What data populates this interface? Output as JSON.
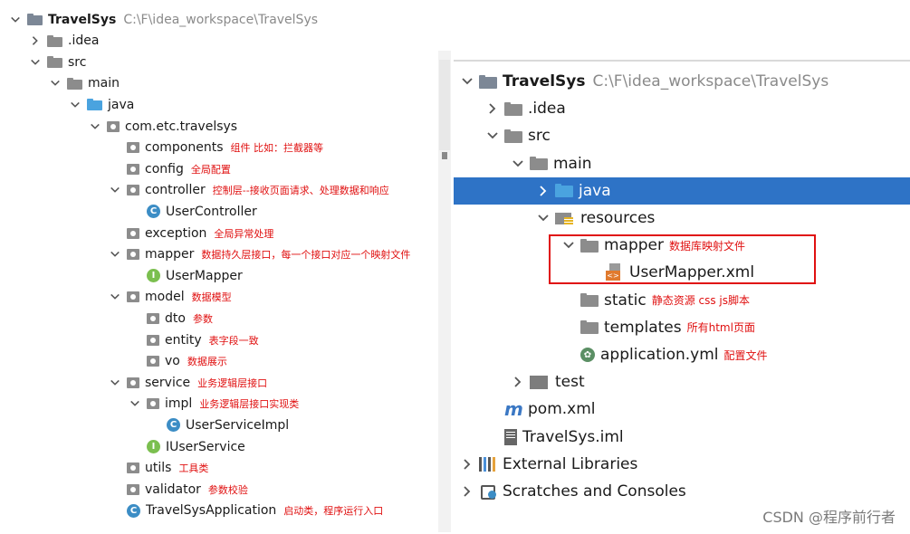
{
  "left_tree": [
    {
      "level": 0,
      "chevron": "down",
      "icon": "project",
      "label": "TravelSys",
      "bold": true,
      "path": "C:\\F\\idea_workspace\\TravelSys"
    },
    {
      "level": 1,
      "chevron": "right",
      "icon": "folder",
      "label": ".idea"
    },
    {
      "level": 1,
      "chevron": "down",
      "icon": "folder",
      "label": "src"
    },
    {
      "level": 2,
      "chevron": "down",
      "icon": "folder",
      "label": "main"
    },
    {
      "level": 3,
      "chevron": "down",
      "icon": "folder-blue",
      "label": "java"
    },
    {
      "level": 4,
      "chevron": "down",
      "icon": "package",
      "label": "com.etc.travelsys"
    },
    {
      "level": 5,
      "chevron": "",
      "icon": "package",
      "label": "components",
      "note": "组件 比如：拦截器等"
    },
    {
      "level": 5,
      "chevron": "",
      "icon": "package",
      "label": "config",
      "note": "全局配置"
    },
    {
      "level": 5,
      "chevron": "down",
      "icon": "package",
      "label": "controller",
      "note": "控制层--接收页面请求、处理数据和响应"
    },
    {
      "level": 6,
      "chevron": "",
      "icon": "class",
      "label": "UserController"
    },
    {
      "level": 5,
      "chevron": "",
      "icon": "package",
      "label": "exception",
      "note": "全局异常处理"
    },
    {
      "level": 5,
      "chevron": "down",
      "icon": "package",
      "label": "mapper",
      "note": "数据持久层接口，每一个接口对应一个映射文件"
    },
    {
      "level": 6,
      "chevron": "",
      "icon": "interface",
      "label": "UserMapper"
    },
    {
      "level": 5,
      "chevron": "down",
      "icon": "package",
      "label": "model",
      "note": "数据模型"
    },
    {
      "level": 6,
      "chevron": "",
      "icon": "package",
      "label": "dto",
      "note": "参数"
    },
    {
      "level": 6,
      "chevron": "",
      "icon": "package",
      "label": "entity",
      "note": "表字段一致"
    },
    {
      "level": 6,
      "chevron": "",
      "icon": "package",
      "label": "vo",
      "note": "数据展示"
    },
    {
      "level": 5,
      "chevron": "down",
      "icon": "package",
      "label": "service",
      "note": "业务逻辑层接口"
    },
    {
      "level": 6,
      "chevron": "down",
      "icon": "package",
      "label": "impl",
      "note": "业务逻辑层接口实现类"
    },
    {
      "level": 7,
      "chevron": "",
      "icon": "class",
      "label": "UserServiceImpl"
    },
    {
      "level": 6,
      "chevron": "",
      "icon": "interface",
      "label": "IUserService"
    },
    {
      "level": 5,
      "chevron": "",
      "icon": "package",
      "label": "utils",
      "note": "工具类"
    },
    {
      "level": 5,
      "chevron": "",
      "icon": "package",
      "label": "validator",
      "note": "参数校验"
    },
    {
      "level": 5,
      "chevron": "",
      "icon": "spring-class",
      "label": "TravelSysApplication",
      "note": "启动类，程序运行入口"
    }
  ],
  "right_tree": [
    {
      "level": 0,
      "chevron": "down",
      "icon": "project",
      "label": "TravelSys",
      "bold": true,
      "path": "C:\\F\\idea_workspace\\TravelSys"
    },
    {
      "level": 1,
      "chevron": "right",
      "icon": "folder",
      "label": ".idea"
    },
    {
      "level": 1,
      "chevron": "down",
      "icon": "folder",
      "label": "src"
    },
    {
      "level": 2,
      "chevron": "down",
      "icon": "folder",
      "label": "main"
    },
    {
      "level": 3,
      "chevron": "right",
      "icon": "folder-blue",
      "label": "java",
      "selected": true
    },
    {
      "level": 3,
      "chevron": "down",
      "icon": "resources",
      "label": "resources"
    },
    {
      "level": 4,
      "chevron": "down",
      "icon": "folder",
      "label": "mapper",
      "note": "数据库映射文件"
    },
    {
      "level": 5,
      "chevron": "",
      "icon": "xml",
      "label": "UserMapper.xml"
    },
    {
      "level": 4,
      "chevron": "",
      "icon": "folder",
      "label": "static",
      "note": "静态资源 css js脚本"
    },
    {
      "level": 4,
      "chevron": "",
      "icon": "folder",
      "label": "templates",
      "note": "所有html页面"
    },
    {
      "level": 4,
      "chevron": "",
      "icon": "spring",
      "label": "application.yml",
      "note": "配置文件"
    },
    {
      "level": 2,
      "chevron": "right",
      "icon": "test",
      "label": "test"
    },
    {
      "level": 1,
      "chevron": "",
      "icon": "maven",
      "label": "pom.xml"
    },
    {
      "level": 1,
      "chevron": "",
      "icon": "iml",
      "label": "TravelSys.iml"
    },
    {
      "level": 0,
      "chevron": "right",
      "icon": "libraries",
      "label": "External Libraries"
    },
    {
      "level": 0,
      "chevron": "right",
      "icon": "scratches",
      "label": "Scratches and Consoles"
    }
  ],
  "watermark": "CSDN @程序前行者"
}
